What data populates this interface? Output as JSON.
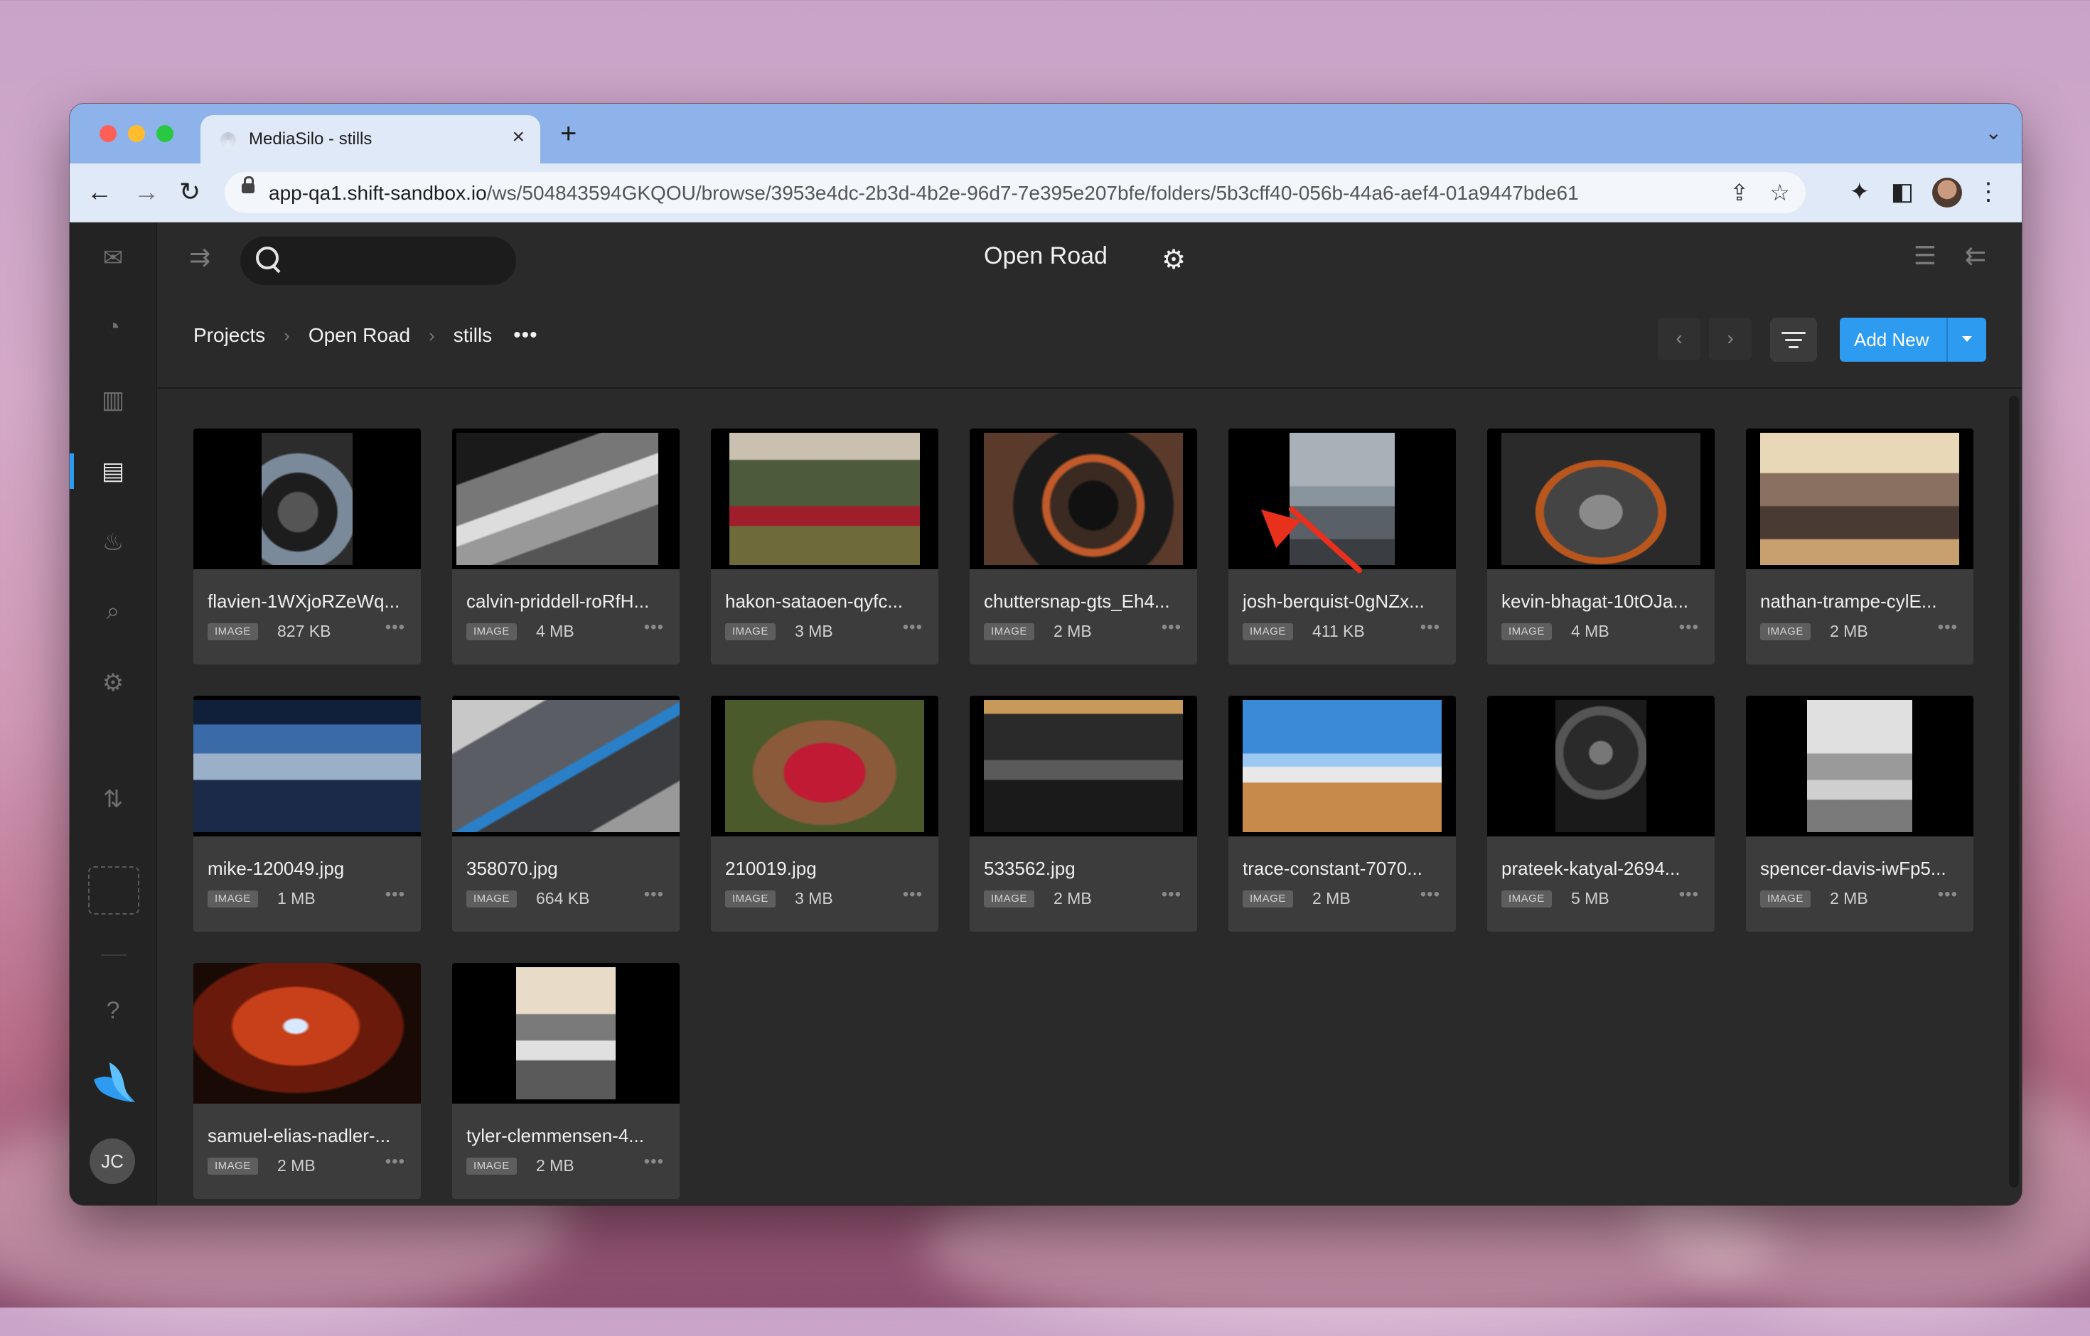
{
  "browser": {
    "tab_title": "MediaSilo - stills",
    "url_host": "app-qa1.shift-sandbox.io",
    "url_path": "/ws/504843594GKQOU/browse/3953e4dc-2b3d-4b2e-96d7-7e395e207bfe/folders/5b3cff40-056b-44a6-aef4-01a9447bde61"
  },
  "header": {
    "project_title": "Open Road",
    "search_placeholder": ""
  },
  "breadcrumb": [
    "Projects",
    "Open Road",
    "stills"
  ],
  "actions": {
    "add_new": "Add New"
  },
  "user": {
    "initials": "JC"
  },
  "files": [
    {
      "name": "flavien-1WXjoRZeWq...",
      "type": "IMAGE",
      "size": "827 KB"
    },
    {
      "name": "calvin-priddell-roRfH...",
      "type": "IMAGE",
      "size": "4 MB"
    },
    {
      "name": "hakon-sataoen-qyfc...",
      "type": "IMAGE",
      "size": "3 MB"
    },
    {
      "name": "chuttersnap-gts_Eh4...",
      "type": "IMAGE",
      "size": "2 MB"
    },
    {
      "name": "josh-berquist-0gNZx...",
      "type": "IMAGE",
      "size": "411 KB"
    },
    {
      "name": "kevin-bhagat-10tOJa...",
      "type": "IMAGE",
      "size": "4 MB"
    },
    {
      "name": "nathan-trampe-cylE...",
      "type": "IMAGE",
      "size": "2 MB"
    },
    {
      "name": "mike-120049.jpg",
      "type": "IMAGE",
      "size": "1 MB"
    },
    {
      "name": "358070.jpg",
      "type": "IMAGE",
      "size": "664 KB"
    },
    {
      "name": "210019.jpg",
      "type": "IMAGE",
      "size": "3 MB"
    },
    {
      "name": "533562.jpg",
      "type": "IMAGE",
      "size": "2 MB"
    },
    {
      "name": "trace-constant-7070...",
      "type": "IMAGE",
      "size": "2 MB"
    },
    {
      "name": "prateek-katyal-2694...",
      "type": "IMAGE",
      "size": "5 MB"
    },
    {
      "name": "spencer-davis-iwFp5...",
      "type": "IMAGE",
      "size": "2 MB"
    },
    {
      "name": "samuel-elias-nadler-...",
      "type": "IMAGE",
      "size": "2 MB"
    },
    {
      "name": "tyler-clemmensen-4...",
      "type": "IMAGE",
      "size": "2 MB"
    }
  ],
  "colors": {
    "accent": "#2d9cf0",
    "annotation_arrow": "#e8301d",
    "app_background": "#2a2a2a",
    "card_background": "#3c3c3c"
  }
}
